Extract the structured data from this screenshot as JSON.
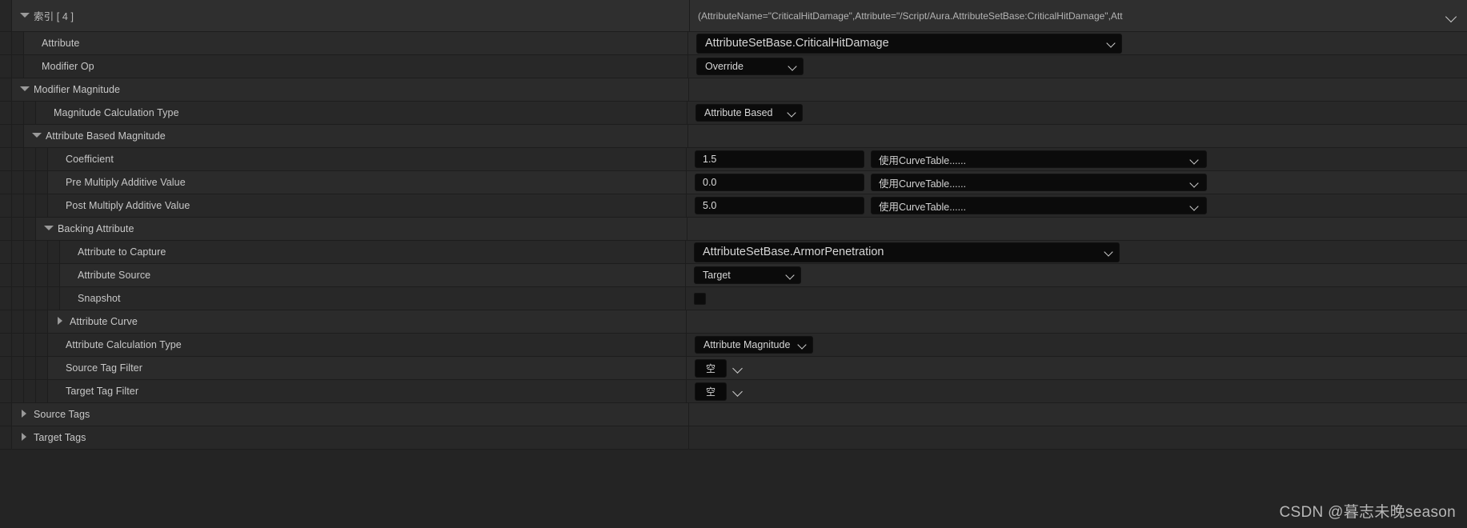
{
  "header": {
    "index_label": "索引 [ 4 ]",
    "index_value": "(AttributeName=\"CriticalHitDamage\",Attribute=\"/Script/Aura.AttributeSetBase:CriticalHitDamage\",Att"
  },
  "rows": [
    {
      "name": "attribute",
      "label": "Attribute",
      "widget": "combo-wide",
      "value": "AttributeSetBase.CriticalHitDamage",
      "indent": 2
    },
    {
      "name": "modifier-op",
      "label": "Modifier Op",
      "widget": "combo-mid",
      "value": "Override",
      "indent": 2
    },
    {
      "name": "modifier-magnitude",
      "label": "Modifier Magnitude",
      "widget": "none",
      "value": "",
      "indent": 1,
      "expander": "expanded"
    },
    {
      "name": "magnitude-calculation-type",
      "label": "Magnitude Calculation Type",
      "widget": "combo-mid",
      "value": "Attribute Based",
      "indent": 3
    },
    {
      "name": "attribute-based-magnitude",
      "label": "Attribute Based Magnitude",
      "widget": "none",
      "value": "",
      "indent": 2,
      "expander": "expanded"
    },
    {
      "name": "coefficient",
      "label": "Coefficient",
      "widget": "num-curve",
      "value": "1.5",
      "curve": "使用CurveTable......",
      "indent": 4
    },
    {
      "name": "pre-multiply-additive-value",
      "label": "Pre Multiply Additive Value",
      "widget": "num-curve",
      "value": "0.0",
      "curve": "使用CurveTable......",
      "indent": 4
    },
    {
      "name": "post-multiply-additive-value",
      "label": "Post Multiply Additive Value",
      "widget": "num-curve",
      "value": "5.0",
      "curve": "使用CurveTable......",
      "indent": 4
    },
    {
      "name": "backing-attribute",
      "label": "Backing Attribute",
      "widget": "none",
      "value": "",
      "indent": 3,
      "expander": "expanded"
    },
    {
      "name": "attribute-to-capture",
      "label": "Attribute to Capture",
      "widget": "combo-wide",
      "value": "AttributeSetBase.ArmorPenetration",
      "indent": 5
    },
    {
      "name": "attribute-source",
      "label": "Attribute Source",
      "widget": "combo-mid",
      "value": "Target",
      "indent": 5
    },
    {
      "name": "snapshot",
      "label": "Snapshot",
      "widget": "checkbox",
      "value": "",
      "checked": false,
      "indent": 5
    },
    {
      "name": "attribute-curve",
      "label": "Attribute Curve",
      "widget": "none",
      "value": "",
      "indent": 4,
      "expander": "collapsed"
    },
    {
      "name": "attribute-calculation-type",
      "label": "Attribute Calculation Type",
      "widget": "combo-mid",
      "value": "Attribute Magnitude",
      "indent": 4
    },
    {
      "name": "source-tag-filter",
      "label": "Source Tag Filter",
      "widget": "tag",
      "value": "空",
      "indent": 4
    },
    {
      "name": "target-tag-filter",
      "label": "Target Tag Filter",
      "widget": "tag",
      "value": "空",
      "indent": 4
    },
    {
      "name": "source-tags",
      "label": "Source Tags",
      "widget": "none",
      "value": "",
      "indent": 1,
      "expander": "collapsed"
    },
    {
      "name": "target-tags",
      "label": "Target Tags",
      "widget": "none",
      "value": "",
      "indent": 1,
      "expander": "collapsed"
    }
  ],
  "watermark": "CSDN @暮志未晚season",
  "colors": {
    "background": "#242424",
    "row": "#2b2b2b",
    "row_alt": "#282828",
    "field": "#0b0b0b",
    "text": "#c8c8c8",
    "divider": "#1d1d1d"
  }
}
